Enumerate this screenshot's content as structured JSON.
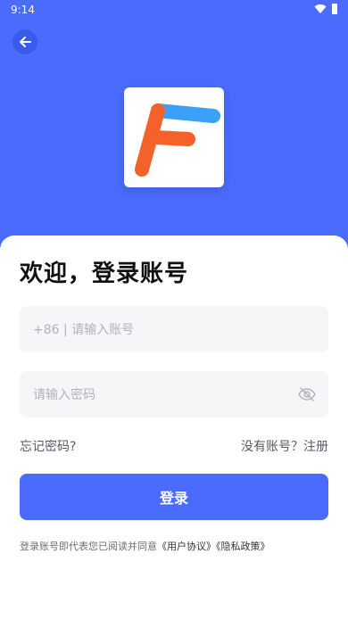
{
  "status_bar": {
    "time": "9:14"
  },
  "header": {
    "back_icon": "arrow-left-icon"
  },
  "logo": {
    "name": "F-logo",
    "colors": {
      "blue": "#3aa0f8",
      "orange": "#f4622a"
    }
  },
  "welcome_title": "欢迎，登录账号",
  "phone_field": {
    "placeholder": "+86 | 请输入账号",
    "value": ""
  },
  "password_field": {
    "placeholder": "请输入密码",
    "value": "",
    "toggle_icon": "eye-off-icon"
  },
  "links": {
    "forgot": "忘记密码?",
    "register": "没有账号？注册"
  },
  "login_button": "登录",
  "agreement": {
    "prefix": "登录账号即代表您已阅读并同意",
    "user_agreement": "《用户协议》",
    "privacy_policy": "《隐私政策》"
  },
  "colors": {
    "primary": "#4a6bfb",
    "field_bg": "#f5f6f8"
  }
}
